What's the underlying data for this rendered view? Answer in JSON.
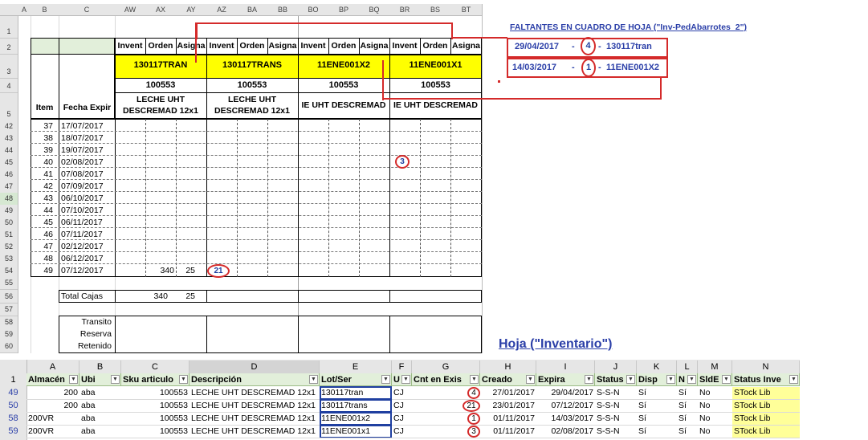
{
  "top_sheet": {
    "col_headers": [
      "A",
      "B",
      "C",
      "AW",
      "AX",
      "AY",
      "AZ",
      "BA",
      "BB",
      "BO",
      "BP",
      "BQ",
      "BR",
      "BS",
      "BT"
    ],
    "row_numbers": [
      "1",
      "2",
      "3",
      "4",
      "5",
      "42",
      "43",
      "44",
      "45",
      "46",
      "47",
      "48",
      "49",
      "50",
      "51",
      "52",
      "53",
      "54",
      "55",
      "56",
      "57",
      "58",
      "59",
      "60"
    ],
    "sub_headers": [
      "Invent",
      "Orden",
      "Asigna",
      "Invent",
      "Orden",
      "Asigna",
      "Invent",
      "Orden",
      "Asigna",
      "Invent",
      "Orden",
      "Asigna"
    ],
    "lot_codes": [
      "130117TRAN",
      "130117TRANS",
      "11ENE001X2",
      "11ENE001X1"
    ],
    "sku_codes": [
      "100553",
      "100553",
      "100553",
      "100553"
    ],
    "desc_1": [
      "LECHE UHT",
      "LECHE UHT"
    ],
    "desc_2": [
      "DESCREMAD 12x1",
      "DESCREMAD 12x1"
    ],
    "desc_cut": [
      "IE UHT DESCREMAD",
      "IE UHT DESCREMAD"
    ],
    "item_label": "Item",
    "fecha_label": "Fecha Expir",
    "items": [
      "37",
      "38",
      "39",
      "40",
      "41",
      "42",
      "43",
      "44",
      "45",
      "46",
      "47",
      "48",
      "49"
    ],
    "fechas": [
      "17/07/2017",
      "18/07/2017",
      "19/07/2017",
      "02/08/2017",
      "07/08/2017",
      "07/09/2017",
      "06/10/2017",
      "07/10/2017",
      "06/11/2017",
      "07/11/2017",
      "02/12/2017",
      "06/12/2017",
      "07/12/2017"
    ],
    "row54_invent": "340",
    "row54_orden": "25",
    "row54_circle": "21",
    "row45_circle": "3",
    "total_label": "Total Cajas",
    "total_invent": "340",
    "total_orden": "25",
    "labels_bottom": [
      "Transito",
      "Reserva",
      "Retenido"
    ]
  },
  "annotations": {
    "title": "FALTANTES EN CUADRO DE HOJA (\"Inv-PedAbarrotes_2\")",
    "line1_date": "29/04/2017",
    "line1_count": "4",
    "line1_code": "130117tran",
    "line2_date": "14/03/2017",
    "line2_count": "1",
    "line2_code": "11ENE001X2",
    "dash": "-",
    "hoja_inventario": "Hoja (\"Inventario\")"
  },
  "bottom_sheet": {
    "col_headers": [
      "A",
      "B",
      "C",
      "D",
      "E",
      "F",
      "G",
      "H",
      "I",
      "J",
      "K",
      "L",
      "M",
      "N"
    ],
    "header_row_num": "1",
    "headers": [
      "Almacén",
      "Ubi",
      "Sku articulo",
      "Descripción",
      "Lot/Ser",
      "U",
      "Cnt en Exis",
      "Creado",
      "Expira",
      "Status",
      "Disp",
      "N",
      "SldE",
      "Status Inve"
    ],
    "rows": [
      {
        "num": "49",
        "almacen": "200",
        "ubi": "aba",
        "sku": "100553",
        "desc": "LECHE UHT DESCREMAD 12x1",
        "lot": "130117tran",
        "u": "CJ",
        "cnt": "4",
        "creado": "27/01/2017",
        "expira": "29/04/2017",
        "status": "S-S-N",
        "disp": "Sí",
        "n": "Sí",
        "sld": "No",
        "stat_inv": "STock Lib"
      },
      {
        "num": "50",
        "almacen": "200",
        "ubi": "aba",
        "sku": "100553",
        "desc": "LECHE UHT DESCREMAD 12x1",
        "lot": "130117trans",
        "u": "CJ",
        "cnt": "21",
        "creado": "23/01/2017",
        "expira": "07/12/2017",
        "status": "S-S-N",
        "disp": "Sí",
        "n": "Sí",
        "sld": "No",
        "stat_inv": "STock Lib"
      },
      {
        "num": "58",
        "almacen": "200VR",
        "ubi": "aba",
        "sku": "100553",
        "desc": "LECHE UHT DESCREMAD 12x1",
        "lot": "11ENE001x2",
        "u": "CJ",
        "cnt": "1",
        "creado": "01/11/2017",
        "expira": "14/03/2017",
        "status": "S-S-N",
        "disp": "Sí",
        "n": "Sí",
        "sld": "No",
        "stat_inv": "STock Lib"
      },
      {
        "num": "59",
        "almacen": "200VR",
        "ubi": "aba",
        "sku": "100553",
        "desc": "LECHE UHT DESCREMAD 12x1",
        "lot": "11ENE001x1",
        "u": "CJ",
        "cnt": "3",
        "creado": "01/11/2017",
        "expira": "02/08/2017",
        "status": "S-S-N",
        "disp": "Sí",
        "n": "Sí",
        "sld": "No",
        "stat_inv": "STock Lib"
      }
    ]
  },
  "colors": {
    "yellow": "#ffff00",
    "red_mark": "#d42a2a",
    "note_blue": "#2b3fa8",
    "header_green": "#e2efda",
    "status_yellow": "#ffff99",
    "lot_box_blue": "#1f3fa0"
  }
}
